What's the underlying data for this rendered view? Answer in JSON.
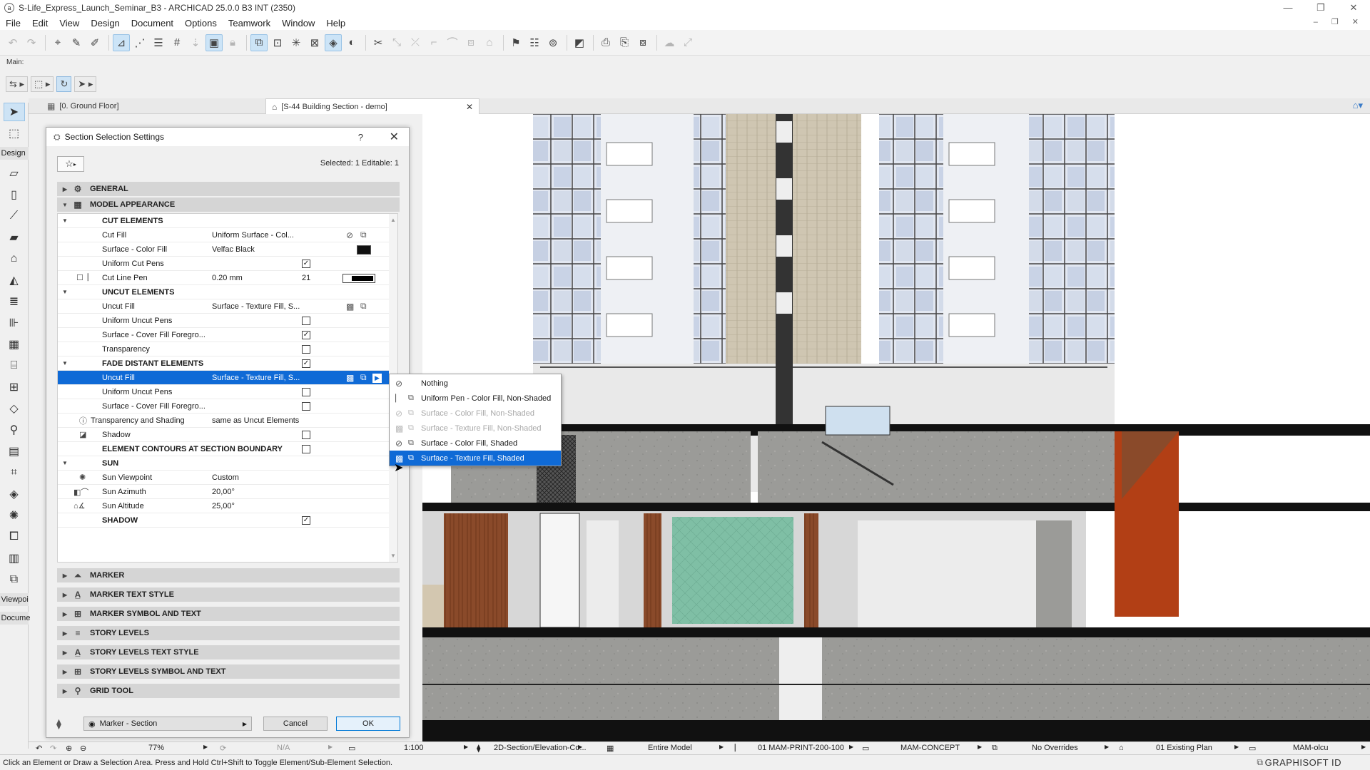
{
  "window": {
    "title": "S-Life_Express_Launch_Seminar_B3 - ARCHICAD 25.0.0 B3 INT (2350)",
    "app_icon": "archicad-logo-icon"
  },
  "menu": [
    "File",
    "Edit",
    "View",
    "Design",
    "Document",
    "Options",
    "Teamwork",
    "Window",
    "Help"
  ],
  "toolbar_label": "Main:",
  "toolbox": {
    "design_label": "Design",
    "viewpoints_label": "Viewpoi",
    "document_label": "Docume"
  },
  "tabs": [
    {
      "label": "[0. Ground Floor]"
    },
    {
      "label": "[S-44 Building Section - demo]"
    }
  ],
  "dialog": {
    "title": "Section Selection Settings",
    "help": "?",
    "close": "✕",
    "selection_info": "Selected: 1 Editable: 1",
    "sections_top": [
      {
        "label": "GENERAL",
        "expanded": false
      },
      {
        "label": "MODEL APPEARANCE",
        "expanded": true
      }
    ],
    "rows": [
      {
        "kind": "group",
        "label": "CUT ELEMENTS",
        "expanded": true
      },
      {
        "kind": "prop",
        "label": "Cut Fill",
        "value": "Uniform Surface - Col...",
        "icons": [
          "fill-type-icon",
          "fill-type-alt-icon"
        ]
      },
      {
        "kind": "prop",
        "label": "Surface - Color Fill",
        "value": "Velfac Black",
        "swatch": "#111111"
      },
      {
        "kind": "check",
        "label": "Uniform Cut Pens",
        "checked": true
      },
      {
        "kind": "prop",
        "label": "Cut Line Pen",
        "value": "0.20 mm",
        "number": "21",
        "pen": true
      },
      {
        "kind": "group",
        "label": "UNCUT ELEMENTS",
        "expanded": true
      },
      {
        "kind": "prop",
        "label": "Uncut Fill",
        "value": "Surface - Texture Fill, S...",
        "icons": [
          "fill-type-icon",
          "fill-type-alt-icon"
        ]
      },
      {
        "kind": "check",
        "label": "Uniform Uncut Pens",
        "checked": false
      },
      {
        "kind": "check",
        "label": "Surface - Cover Fill Foregro...",
        "checked": true
      },
      {
        "kind": "check",
        "label": "Transparency",
        "checked": false
      },
      {
        "kind": "groupcheck",
        "label": "FADE DISTANT ELEMENTS",
        "expanded": true,
        "checked": true
      },
      {
        "kind": "prop",
        "label": "Uncut Fill",
        "value": "Surface - Texture Fill, S...",
        "selected": true,
        "icons": [
          "fill-type-icon",
          "fill-type-alt-icon",
          "arrow-right-icon"
        ]
      },
      {
        "kind": "check",
        "label": "Uniform Uncut Pens",
        "checked": false
      },
      {
        "kind": "check",
        "label": "Surface - Cover Fill Foregro...",
        "checked": false
      },
      {
        "kind": "prop",
        "label": "Transparency and Shading",
        "value": "same as Uncut Elements",
        "icon": "info-icon"
      },
      {
        "kind": "check",
        "label": "Shadow",
        "checked": false,
        "icon": "shadow-icon"
      },
      {
        "kind": "groupcheck",
        "label": "ELEMENT CONTOURS AT SECTION BOUNDARY",
        "checked": false
      },
      {
        "kind": "group",
        "label": "SUN",
        "expanded": true
      },
      {
        "kind": "prop",
        "label": "Sun Viewpoint",
        "value": "Custom",
        "icon": "sun-icon"
      },
      {
        "kind": "prop",
        "label": "Sun Azimuth",
        "value": "20,00°",
        "icon": "azimuth-icon"
      },
      {
        "kind": "prop",
        "label": "Sun Altitude",
        "value": "25,00°",
        "icon": "altitude-icon"
      },
      {
        "kind": "groupcheck",
        "label": "SHADOW",
        "checked": true
      }
    ],
    "sections_bottom": [
      {
        "label": "MARKER",
        "icon": "marker-icon"
      },
      {
        "label": "MARKER TEXT STYLE",
        "icon": "text-style-icon"
      },
      {
        "label": "MARKER SYMBOL AND TEXT",
        "icon": "symbol-text-icon"
      },
      {
        "label": "STORY LEVELS",
        "icon": "story-levels-icon"
      },
      {
        "label": "STORY LEVELS TEXT STYLE",
        "icon": "text-style-icon"
      },
      {
        "label": "STORY LEVELS SYMBOL AND TEXT",
        "icon": "symbol-text-icon"
      },
      {
        "label": "GRID TOOL",
        "icon": "grid-tool-icon"
      }
    ],
    "footer": {
      "layer": "Marker - Section",
      "cancel": "Cancel",
      "ok": "OK"
    }
  },
  "popup": [
    {
      "label": "Nothing",
      "state": "normal"
    },
    {
      "label": "Uniform Pen - Color Fill, Non-Shaded",
      "state": "normal"
    },
    {
      "label": "Surface - Color Fill, Non-Shaded",
      "state": "disabled"
    },
    {
      "label": "Surface - Texture Fill, Non-Shaded",
      "state": "disabled"
    },
    {
      "label": "Surface - Color Fill, Shaded",
      "state": "normal"
    },
    {
      "label": "Surface - Texture Fill, Shaded",
      "state": "selected"
    }
  ],
  "status": {
    "zoom": "77%",
    "angle": "N/A",
    "scale": "1:100",
    "view": "2D-Section/Elevation-Co...",
    "model": "Entire Model",
    "pen_set": "01 MAM-PRINT-200-100",
    "mvo": "MAM-CONCEPT",
    "overrides": "No Overrides",
    "renovation": "01 Existing Plan",
    "dimension": "MAM-olcu"
  },
  "hint": "Click an Element or Draw a Selection Area. Press and Hold Ctrl+Shift to Toggle Element/Sub-Element Selection.",
  "brand": "GRAPHISOFT ID",
  "colors": {
    "selection": "#0f6ad6",
    "section_header": "#d5d5d5",
    "concrete": "#9a9a98",
    "wood": "#8a4a2a",
    "glass_green": "#7fbfa5",
    "cladding": "#cfc6b2"
  }
}
